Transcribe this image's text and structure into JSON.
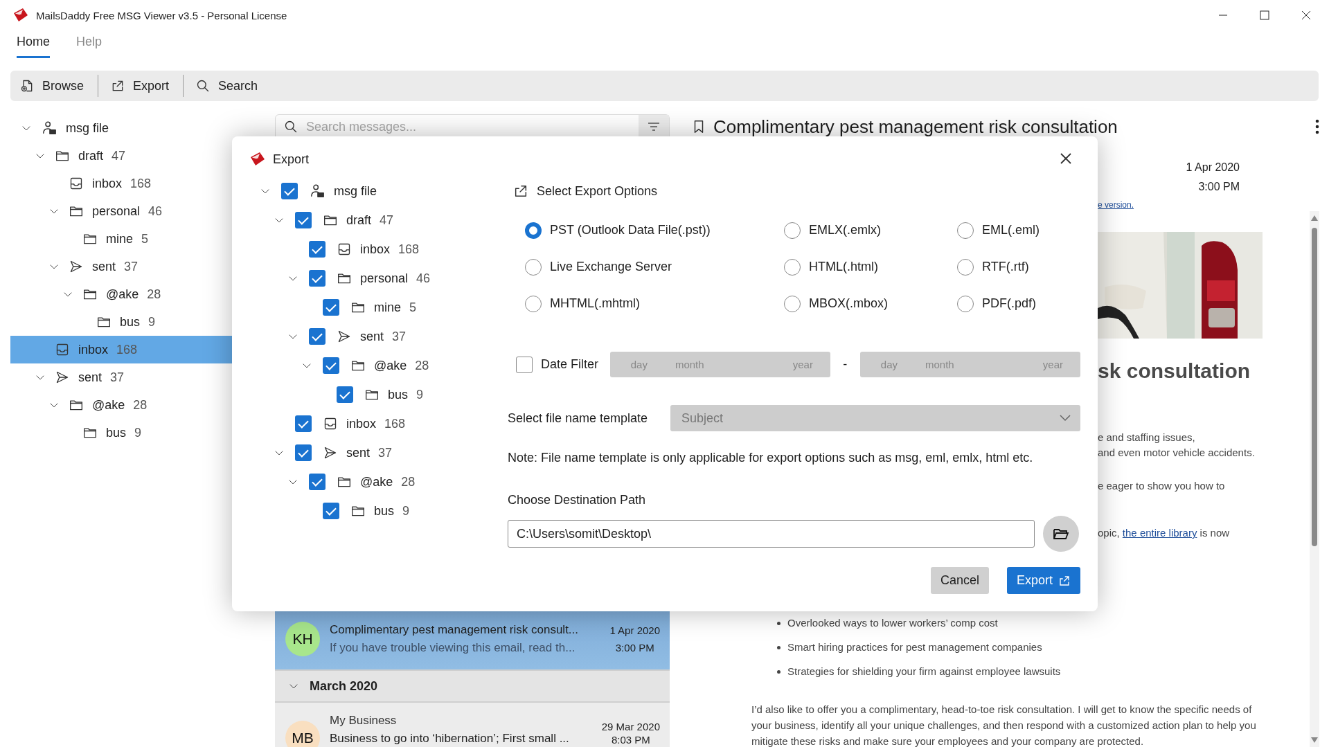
{
  "window": {
    "title": "MailsDaddy Free MSG Viewer v3.5 - Personal License"
  },
  "menu_tabs": [
    {
      "label": "Home",
      "selected": true
    },
    {
      "label": "Help",
      "selected": false
    }
  ],
  "toolbar": [
    {
      "label": "Browse",
      "kind": "browse"
    },
    {
      "label": "Export",
      "kind": "export"
    },
    {
      "label": "Search",
      "kind": "search"
    }
  ],
  "folder_tree": [
    {
      "label": "msg file",
      "kind": "file",
      "expanded": true,
      "selected": false,
      "children": [
        {
          "label": "draft",
          "count": "47",
          "kind": "folder",
          "expanded": true,
          "selected": false,
          "children": [
            {
              "label": "inbox",
              "count": "168",
              "kind": "inbox",
              "selected": false
            },
            {
              "label": "personal",
              "count": "46",
              "kind": "folder",
              "expanded": true,
              "selected": false,
              "children": [
                {
                  "label": "mine",
                  "count": "5",
                  "kind": "folder",
                  "selected": false
                }
              ]
            },
            {
              "label": "sent",
              "count": "37",
              "kind": "sent",
              "expanded": true,
              "selected": false,
              "children": [
                {
                  "label": "@ake",
                  "count": "28",
                  "kind": "folder",
                  "expanded": true,
                  "selected": false,
                  "children": [
                    {
                      "label": "bus",
                      "count": "9",
                      "kind": "folder",
                      "selected": false
                    }
                  ]
                }
              ]
            }
          ]
        },
        {
          "label": "inbox",
          "count": "168",
          "kind": "inbox",
          "selected": true
        },
        {
          "label": "sent",
          "count": "37",
          "kind": "sent",
          "expanded": true,
          "selected": false,
          "children": [
            {
              "label": "@ake",
              "count": "28",
              "kind": "folder",
              "expanded": true,
              "selected": false,
              "children": [
                {
                  "label": "bus",
                  "count": "9",
                  "kind": "folder",
                  "selected": false
                }
              ]
            }
          ]
        }
      ]
    }
  ],
  "message_search": {
    "placeholder": "Search messages..."
  },
  "messages": [
    {
      "kind": "message",
      "initials": "KH",
      "color": "#a8e68c",
      "subject": "Complimentary pest management risk consult...",
      "preview": "If you have trouble viewing this email, read th...",
      "date": "1 Apr 2020",
      "time": "3:00 PM",
      "selected": true
    },
    {
      "kind": "group",
      "label": "March 2020",
      "expanded": true
    },
    {
      "kind": "message",
      "sender": "My Business",
      "initials": "MB",
      "color": "#f9dfc0",
      "subject": "Business to go into ‘hibernation’; First small ...",
      "date": "29 Mar 2020",
      "time": "8:03 PM",
      "selected": false
    }
  ],
  "reading_pane": {
    "title": "Complimentary pest management risk consultation",
    "date": "1 Apr 2020",
    "time": "3:00 PM",
    "link_fragment": "e version.",
    "heading_fragment": "sk consultation",
    "fragments": [
      {
        "before": "e and staffing issues,"
      },
      {
        "before": "and even motor vehicle accidents."
      },
      {
        "before": "e eager to show you how to"
      },
      {
        "before": "opic, ",
        "link": "the entire library",
        "after": " is now"
      }
    ],
    "bullets": [
      "Overlooked ways to lower workers’ comp cost",
      "Smart hiring practices for pest management companies",
      "Strategies for shielding your firm against employee lawsuits"
    ],
    "paragraph": "I’d also like to offer you a complimentary, head-to-toe risk consultation. I will get to know the specific needs of your business, identify all your unique challenges, and then respond with a customized action plan to help you mitigate these risks and make sure your employees and your company are protected."
  },
  "export_dialog": {
    "title": "Export",
    "tree": [
      {
        "label": "msg file",
        "kind": "file",
        "expanded": true,
        "checked": true,
        "children": [
          {
            "label": "draft",
            "count": "47",
            "kind": "folder",
            "expanded": true,
            "checked": true,
            "children": [
              {
                "label": "inbox",
                "count": "168",
                "kind": "inbox",
                "checked": true
              },
              {
                "label": "personal",
                "count": "46",
                "kind": "folder",
                "expanded": true,
                "checked": true,
                "children": [
                  {
                    "label": "mine",
                    "count": "5",
                    "kind": "folder",
                    "checked": true
                  }
                ]
              },
              {
                "label": "sent",
                "count": "37",
                "kind": "sent",
                "expanded": true,
                "checked": true,
                "children": [
                  {
                    "label": "@ake",
                    "count": "28",
                    "kind": "folder",
                    "expanded": true,
                    "checked": true,
                    "children": [
                      {
                        "label": "bus",
                        "count": "9",
                        "kind": "folder",
                        "checked": true
                      }
                    ]
                  }
                ]
              }
            ]
          },
          {
            "label": "inbox",
            "count": "168",
            "kind": "inbox",
            "checked": true
          },
          {
            "label": "sent",
            "count": "37",
            "kind": "sent",
            "expanded": true,
            "checked": true,
            "children": [
              {
                "label": "@ake",
                "count": "28",
                "kind": "folder",
                "expanded": true,
                "checked": true,
                "children": [
                  {
                    "label": "bus",
                    "count": "9",
                    "kind": "folder",
                    "checked": true
                  }
                ]
              }
            ]
          }
        ]
      }
    ],
    "options_heading": "Select Export Options",
    "formats": [
      {
        "label": "PST (Outlook Data File(.pst))",
        "selected": true
      },
      {
        "label": "EMLX(.emlx)",
        "selected": false
      },
      {
        "label": "EML(.eml)",
        "selected": false
      },
      {
        "label": "Live Exchange Server",
        "selected": false
      },
      {
        "label": "HTML(.html)",
        "selected": false
      },
      {
        "label": "RTF(.rtf)",
        "selected": false
      },
      {
        "label": "MHTML(.mhtml)",
        "selected": false
      },
      {
        "label": "MBOX(.mbox)",
        "selected": false
      },
      {
        "label": "PDF(.pdf)",
        "selected": false
      }
    ],
    "date_filter": {
      "label": "Date Filter",
      "checked": false,
      "separator": "-",
      "from": {
        "day": "day",
        "month": "month",
        "year": "year"
      },
      "to": {
        "day": "day",
        "month": "month",
        "year": "year"
      }
    },
    "template": {
      "label": "Select file name template",
      "value": "Subject",
      "disabled": true
    },
    "note": "Note: File name template is only applicable for export options such as msg, eml, emlx, html etc.",
    "destination": {
      "label": "Choose Destination Path",
      "value": "C:\\Users\\somit\\Desktop\\"
    },
    "buttons": [
      {
        "label": "Cancel",
        "kind": "secondary"
      },
      {
        "label": "Export",
        "kind": "primary"
      }
    ]
  }
}
